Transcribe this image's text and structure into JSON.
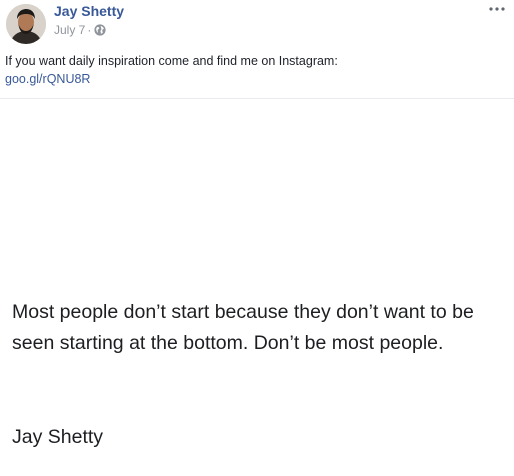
{
  "post": {
    "author_name": "Jay Shetty",
    "date": "July 7",
    "meta_separator": "·",
    "privacy_icon": "globe-icon",
    "more_options_icon": "ellipsis-icon",
    "text": "If you want daily inspiration come and find me on Instagram:",
    "link": "goo.gl/rQNU8R"
  },
  "image": {
    "quote": "Most people don’t start because they don’t want to be seen starting at the bottom. Don’t be most people.",
    "attribution": "Jay Shetty"
  },
  "colors": {
    "link": "#385898",
    "meta": "#90949c",
    "text": "#1d2129"
  }
}
